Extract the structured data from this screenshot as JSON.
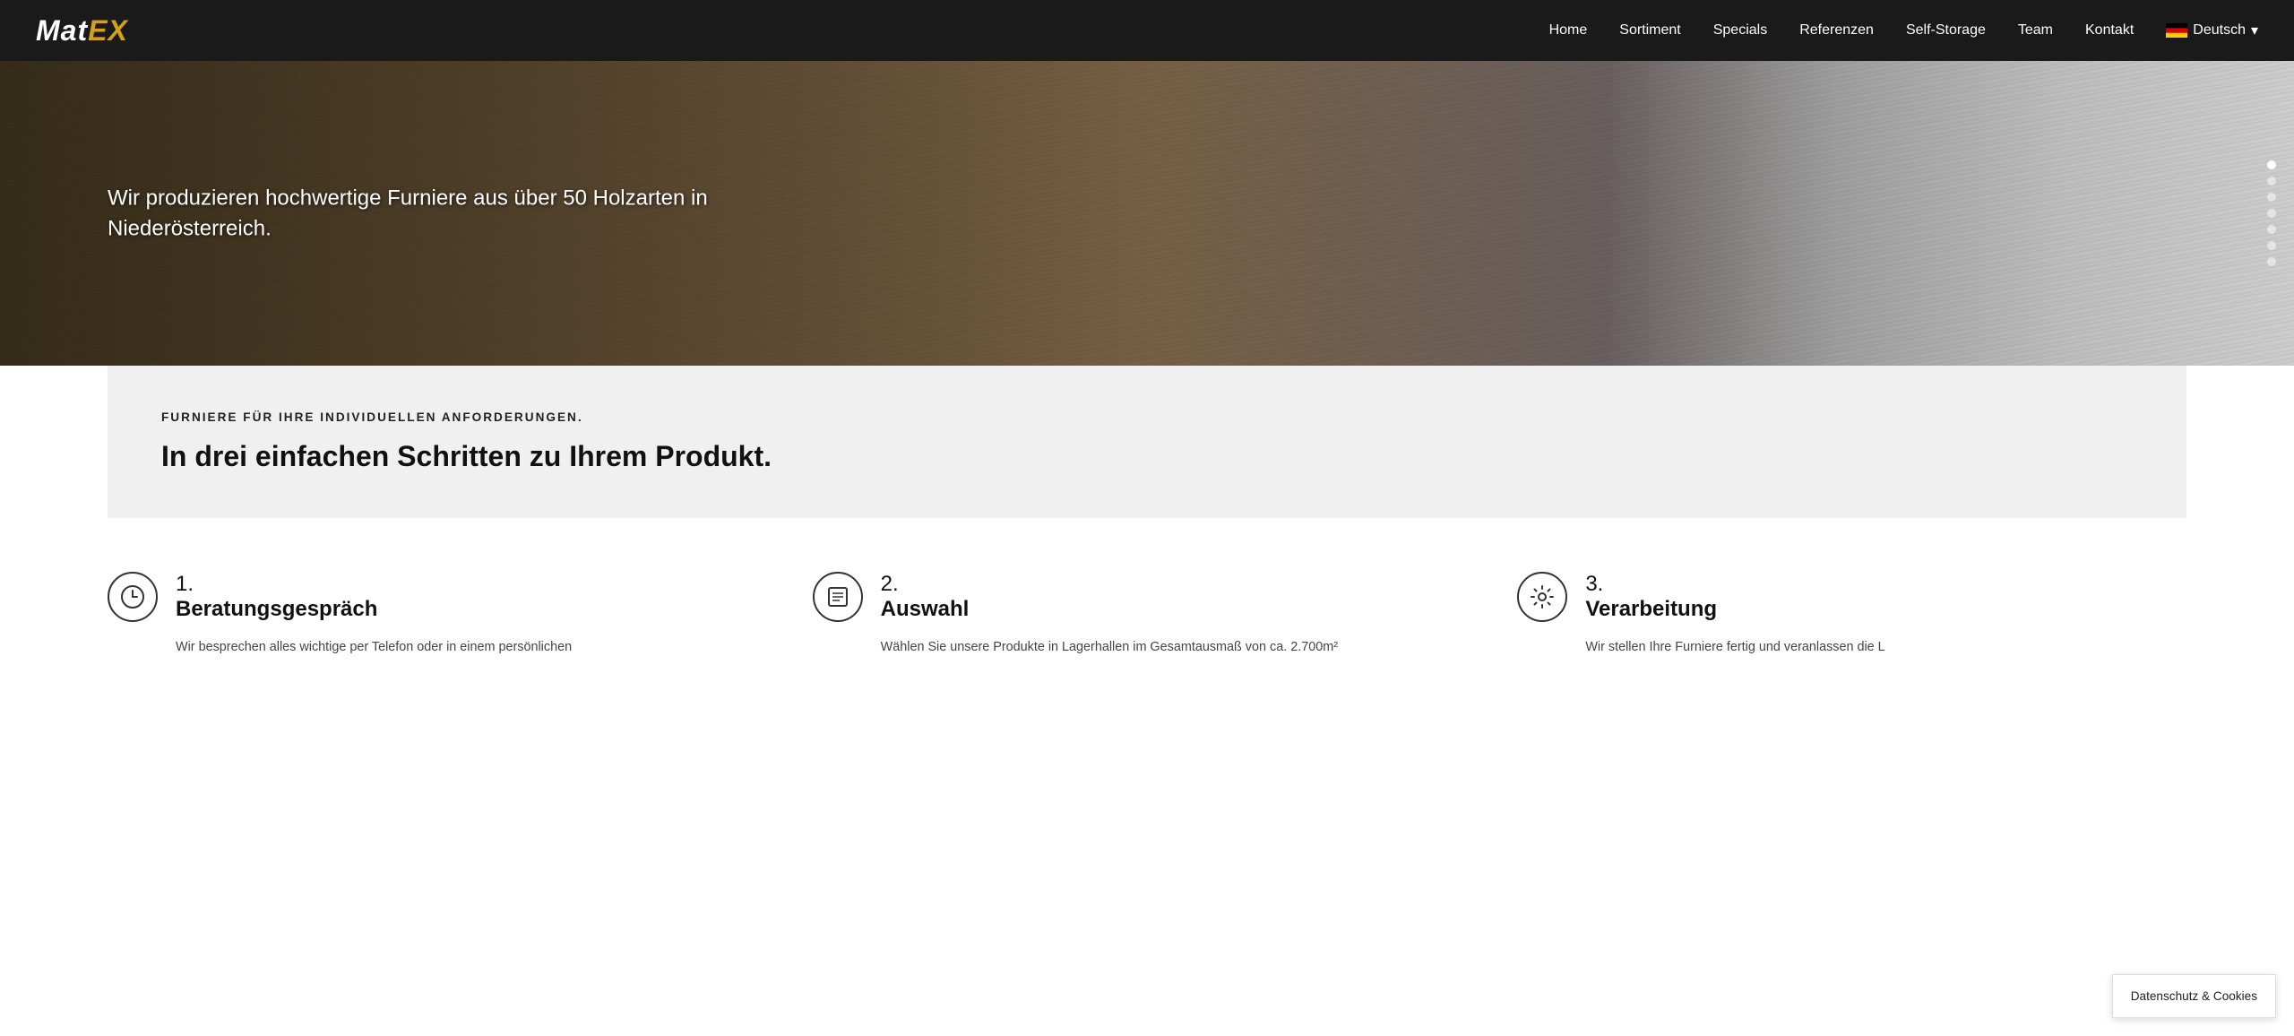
{
  "navbar": {
    "logo_mat": "Mat",
    "logo_ex": "EX",
    "links": [
      {
        "label": "Home",
        "href": "#"
      },
      {
        "label": "Sortiment",
        "href": "#"
      },
      {
        "label": "Specials",
        "href": "#"
      },
      {
        "label": "Referenzen",
        "href": "#"
      },
      {
        "label": "Self-Storage",
        "href": "#"
      },
      {
        "label": "Team",
        "href": "#"
      },
      {
        "label": "Kontakt",
        "href": "#"
      }
    ],
    "language_label": "Deutsch",
    "language_dropdown_icon": "▾"
  },
  "hero": {
    "text": "Wir produzieren hochwertige Furniere aus über 50 Holzarten in Niederösterreich.",
    "dots": [
      {
        "active": true
      },
      {
        "active": false
      },
      {
        "active": false
      },
      {
        "active": false
      },
      {
        "active": false
      },
      {
        "active": false
      },
      {
        "active": false
      }
    ]
  },
  "steps_intro": {
    "subtitle": "FURNIERE FÜR IHRE INDIVIDUELLEN ANFORDERUNGEN.",
    "title": "In drei einfachen Schritten zu Ihrem Produkt."
  },
  "steps": [
    {
      "number": "1.",
      "title": "Beratungsgespräch",
      "icon_symbol": "🕐",
      "icon_name": "phone-clock-icon",
      "description": "Wir besprechen alles wichtige per Telefon oder in einem persönlichen"
    },
    {
      "number": "2.",
      "title": "Auswahl",
      "icon_symbol": "📋",
      "icon_name": "list-icon",
      "description": "Wählen Sie unsere Produkte in Lagerhallen im Gesamtausmaß von ca. 2.700m²"
    },
    {
      "number": "3.",
      "title": "Verarbeitung",
      "icon_symbol": "⚙",
      "icon_name": "gear-icon",
      "description": "Wir stellen Ihre Furniere fertig und veranlassen die L"
    }
  ],
  "cookie_banner": {
    "label": "Datenschutz & Cookies"
  }
}
